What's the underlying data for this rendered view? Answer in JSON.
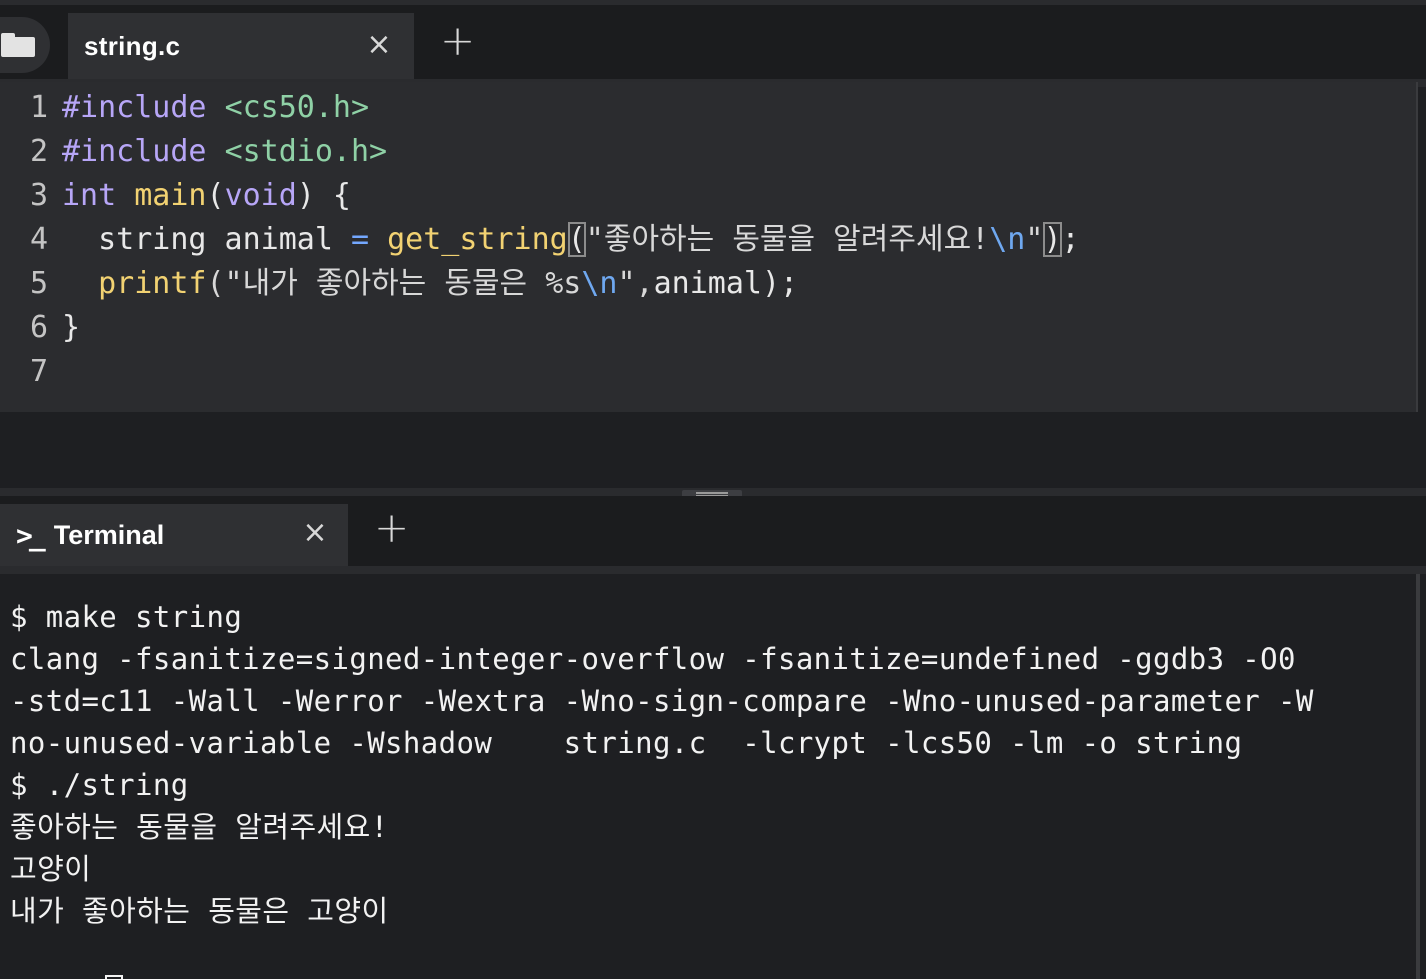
{
  "editor_tabs": {
    "file_tab_label": "string.c",
    "close_glyph": "×",
    "add_glyph": "+"
  },
  "editor": {
    "line_numbers": [
      "1",
      "2",
      "3",
      "4",
      "5",
      "6",
      "7"
    ],
    "lines": [
      {
        "tokens": [
          {
            "t": "#include ",
            "c": "kw"
          },
          {
            "t": "<cs50.h>",
            "c": "hdr"
          }
        ]
      },
      {
        "tokens": [
          {
            "t": "#include ",
            "c": "kw"
          },
          {
            "t": "<stdio.h>",
            "c": "hdr"
          }
        ]
      },
      {
        "tokens": [
          {
            "t": "int ",
            "c": "kw"
          },
          {
            "t": "main",
            "c": "fn"
          },
          {
            "t": "(",
            "c": ""
          },
          {
            "t": "void",
            "c": "kw"
          },
          {
            "t": ") {",
            "c": ""
          }
        ]
      },
      {
        "tokens": [
          {
            "t": "  string animal ",
            "c": ""
          },
          {
            "t": "=",
            "c": "op"
          },
          {
            "t": " ",
            "c": ""
          },
          {
            "t": "get_string",
            "c": "fn"
          },
          {
            "t": "(",
            "c": "bracket-hl"
          },
          {
            "t": "\"좋아하는 동물을 알려주세요!",
            "c": "str"
          },
          {
            "t": "\\n",
            "c": "esc"
          },
          {
            "t": "\"",
            "c": "str"
          },
          {
            "t": ")",
            "c": "bracket-hl"
          },
          {
            "t": ";",
            "c": ""
          }
        ]
      },
      {
        "tokens": [
          {
            "t": "  ",
            "c": ""
          },
          {
            "t": "printf",
            "c": "fn"
          },
          {
            "t": "(\"내가 좋아하는 동물은 %s",
            "c": "str"
          },
          {
            "t": "\\n",
            "c": "esc"
          },
          {
            "t": "\",",
            "c": "str"
          },
          {
            "t": "animal);",
            "c": ""
          }
        ]
      },
      {
        "tokens": [
          {
            "t": "}",
            "c": ""
          }
        ]
      },
      {
        "tokens": []
      }
    ]
  },
  "terminal_tabs": {
    "prompt_icon": ">_",
    "label": "Terminal",
    "close_glyph": "×",
    "add_glyph": "+"
  },
  "terminal": {
    "lines": [
      "$ make string",
      "clang -fsanitize=signed-integer-overflow -fsanitize=undefined -ggdb3 -O0",
      "-std=c11 -Wall -Werror -Wextra -Wno-sign-compare -Wno-unused-parameter -W",
      "no-unused-variable -Wshadow    string.c  -lcrypt -lcs50 -lm -o string",
      "$ ./string",
      "좋아하는 동물을 알려주세요!",
      "고양이",
      "내가 좋아하는 동물은 고양이"
    ],
    "prompt": "$"
  }
}
